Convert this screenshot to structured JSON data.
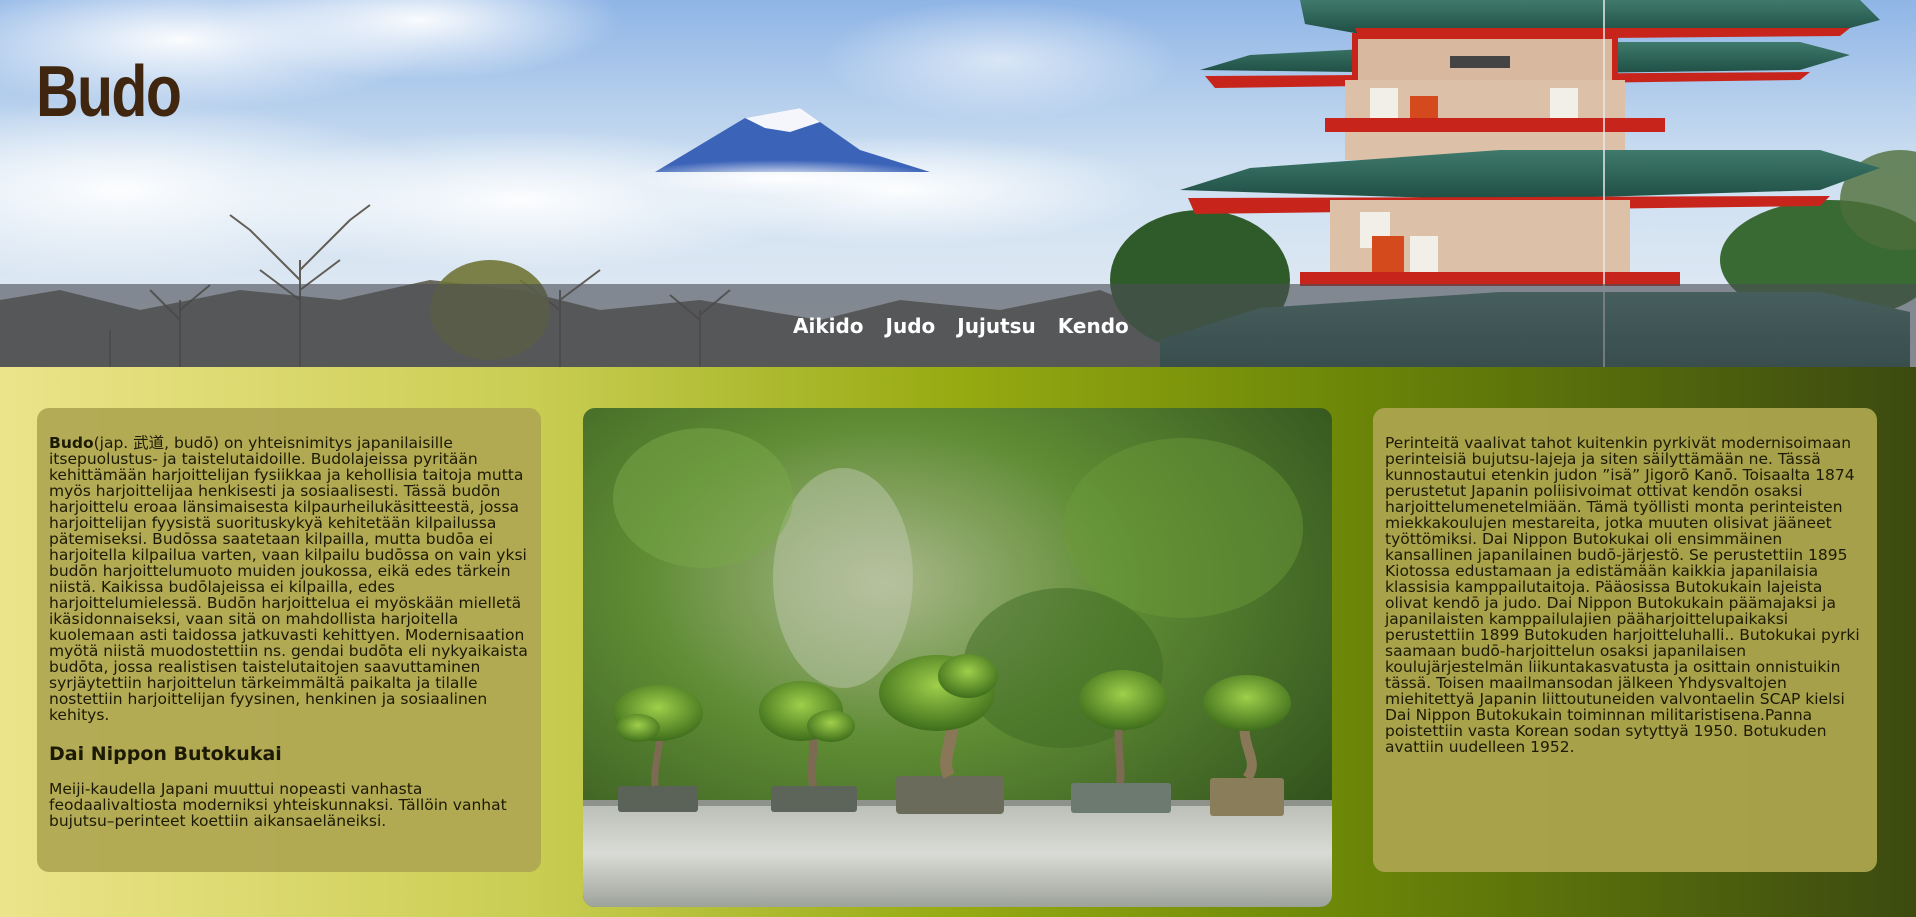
{
  "header": {
    "title": "Budo"
  },
  "nav": {
    "items": [
      "Aikido",
      "Judo",
      "Jujutsu",
      "Kendo"
    ]
  },
  "left_card": {
    "intro_bold": "Budo",
    "intro_text": "(jap. 武道, budō) on yhteisnimitys japanilaisille itsepuolustus- ja taistelutaidoille. Budolajeissa pyritään kehittämään harjoittelijan fysiikkaa ja kehollisia taitoja mutta myös harjoittelijaa henkisesti ja sosiaalisesti. Tässä budōn harjoittelu eroaa länsimaisesta kilpaurheilukäsitteestä, jossa harjoittelijan fyysistä suorituskykyä kehitetään kilpailussa pätemiseksi. Budōssa saatetaan kilpailla, mutta budōa ei harjoitella kilpailua varten, vaan kilpailu budōssa on vain yksi budōn harjoittelumuoto muiden joukossa, eikä edes tärkein niistä. Kaikissa budōlajeissa ei kilpailla, edes harjoittelumielessä. Budōn harjoittelua ei myöskään mielletä ikäsidonnaiseksi, vaan sitä on mahdollista harjoitella kuolemaan asti taidossa jatkuvasti kehittyen. Modernisaation myötä niistä muodostettiin ns. gendai budōta eli nykyaikaista budōta, jossa realistisen taistelutaitojen saavuttaminen syrjäytettiin harjoittelun tärkeimmältä paikalta ja tilalle nostettiin harjoittelijan fyysinen, henkinen ja sosiaalinen kehitys.",
    "heading": "Dai Nippon Butokukai",
    "paragraph2": "Meiji-kaudella Japani muuttui nopeasti vanhasta feodaalivaltiosta moderniksi yhteiskunnaksi. Tällöin vanhat bujutsu–perinteet koettiin aikansaeläneiksi."
  },
  "right_card": {
    "text": "Perinteitä vaalivat tahot kuitenkin pyrkivät modernisoimaan perinteisiä bujutsu-lajeja ja siten säilyttämään ne. Tässä kunnostautui etenkin judon ”isä” Jigorō Kanō. Toisaalta 1874 perustetut Japanin poliisivoimat ottivat kendōn osaksi harjoittelumenetelmiään. Tämä työllisti monta perinteisten miekkakoulujen mestareita, jotka muuten olisivat jääneet työttömiksi. Dai Nippon Butokukai oli ensimmäinen kansallinen japanilainen budō-järjestö. Se perustettiin 1895 Kiotossa edustamaan ja edistämään kaikkia japanilaisia klassisia kamppailutaitoja. Pääosissa Butokukain lajeista olivat kendō ja judo. Dai Nippon Butokukain päämajaksi ja japanilaisten kamppailulajien pääharjoittelupaikaksi perustettiin 1899 Butokuden harjoitteluhalli.. Butokukai pyrki saamaan budō-harjoittelun osaksi japanilaisen koulujärjestelmän liikuntakasvatusta ja osittain onnistuikin tässä. Toisen maailmansodan jälkeen Yhdysvaltojen miehitettyä Japanin liittoutuneiden valvontaelin SCAP kielsi Dai Nippon Butokukain toiminnan militaristisena.Panna poistettiin vasta Korean sodan sytyttyä 1950. Botukuden avattiin uudelleen 1952."
  },
  "images": {
    "hero": "mount-fuji-pagoda-banner",
    "photo": "five-bonsai-trees-photo"
  },
  "colors": {
    "title": "#40260e",
    "nav_text": "#ffffff",
    "card_bg": "#b0a852",
    "body_text": "#1c1a04"
  }
}
